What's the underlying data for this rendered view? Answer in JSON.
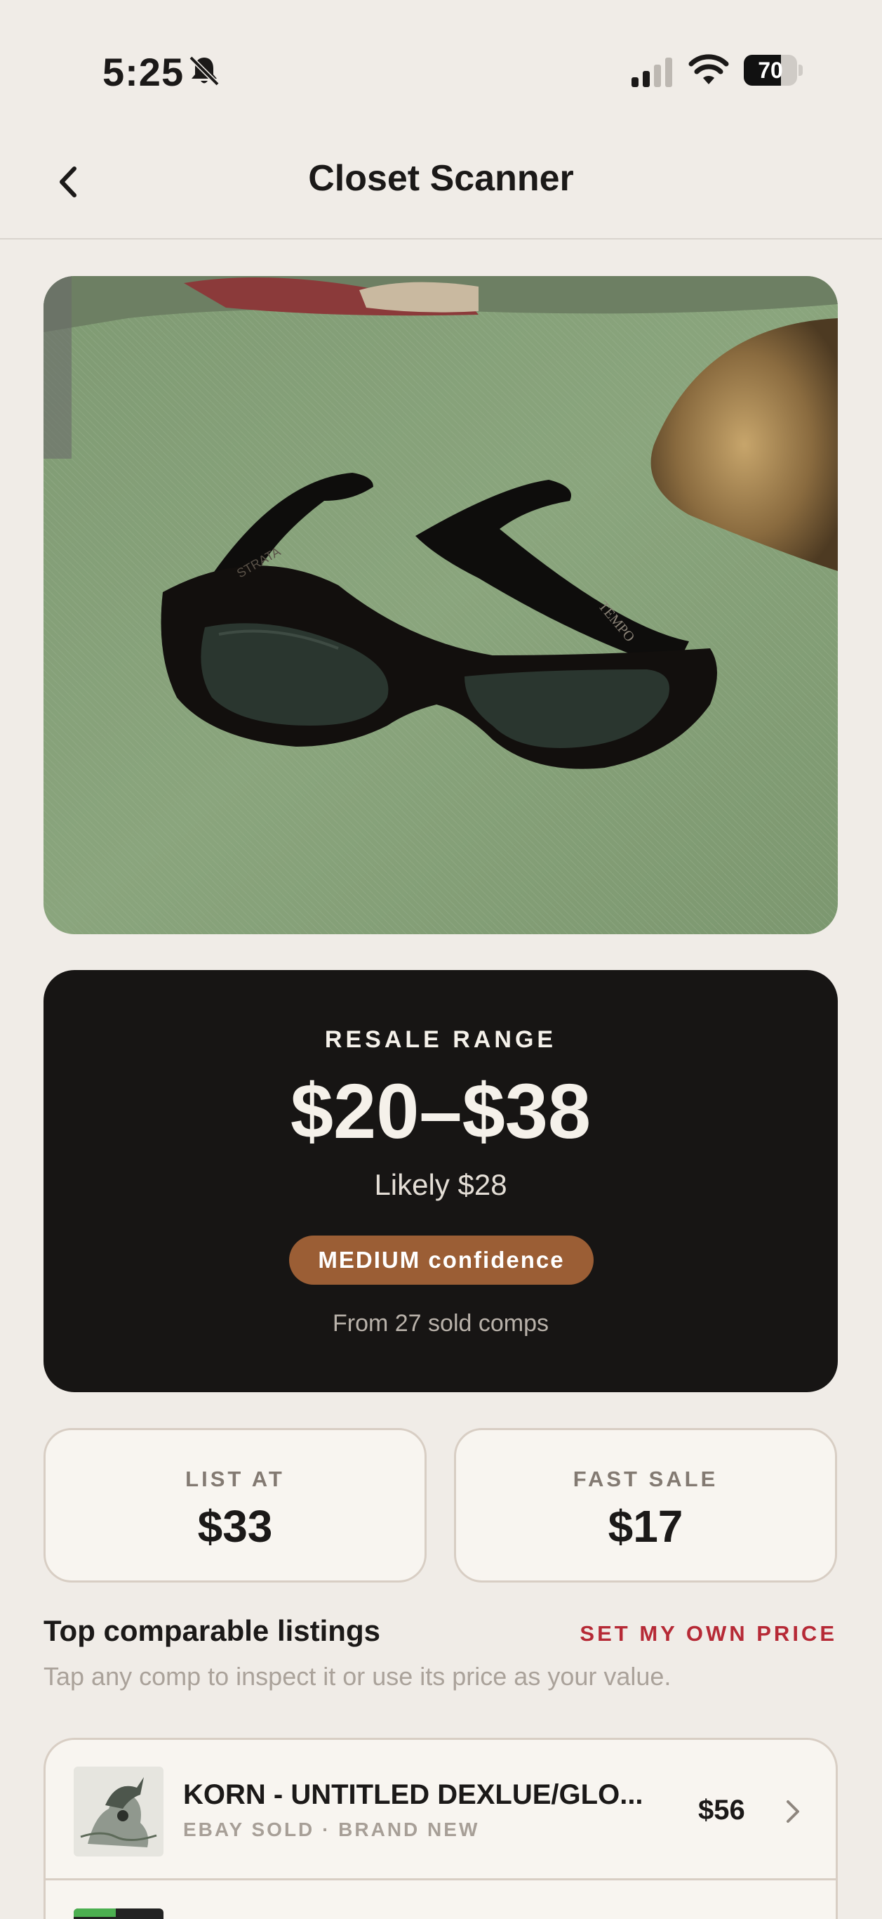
{
  "status": {
    "time": "5:25",
    "battery_percent": 70,
    "battery_label": "70"
  },
  "nav": {
    "title": "Closet Scanner"
  },
  "photo": {
    "frame_text_left": "STRATA",
    "frame_text_right": "TEMPO"
  },
  "resale": {
    "label": "RESALE RANGE",
    "range": "$20–$38",
    "likely": "Likely $28",
    "confidence": "MEDIUM confidence",
    "comps": "From 27 sold comps"
  },
  "prices": {
    "list_label": "LIST AT",
    "list_value": "$33",
    "fast_label": "FAST SALE",
    "fast_value": "$17"
  },
  "comparables": {
    "title": "Top comparable listings",
    "action": "SET MY OWN PRICE",
    "subtitle": "Tap any comp to inspect it or use its price as your value.",
    "items": [
      {
        "title": "KORN - UNTITLED DEXLUE/GLO...",
        "source": "EBAY SOLD",
        "condition": "· BRAND NEW",
        "price": "$56"
      }
    ]
  },
  "colors": {
    "background": "#f0ece7",
    "card_dark": "#171514",
    "confidence_badge": "#9b5e35",
    "accent_red": "#b62a36"
  },
  "icons": {
    "back": "chevron-left-icon",
    "mute": "bell-slash-icon",
    "signal": "cellular-signal-icon",
    "wifi": "wifi-icon",
    "battery": "battery-icon",
    "row_chevron": "chevron-right-icon"
  }
}
